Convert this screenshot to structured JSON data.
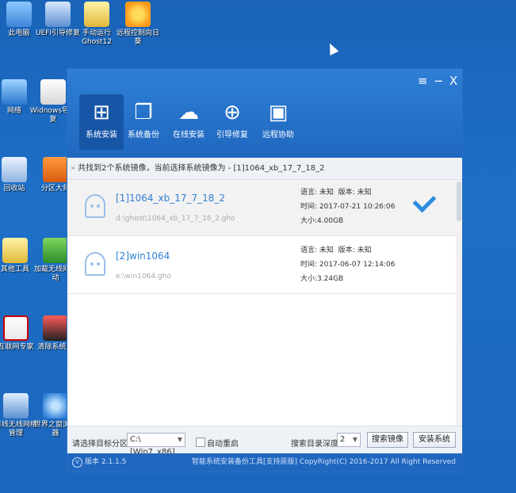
{
  "desktop": {
    "icons": [
      {
        "label": "此电脑",
        "icon": "computer-icon"
      },
      {
        "label": "UEFI引导修复",
        "icon": "tool-icon"
      },
      {
        "label": "手动运行Ghost12",
        "icon": "ghost-icon"
      },
      {
        "label": "远程控制向日葵",
        "icon": "sunflower-icon"
      },
      {
        "label": "网络",
        "icon": "network-icon"
      },
      {
        "label": "Widnows导修复",
        "icon": "windows-repair-icon"
      },
      {
        "label": "回收站",
        "icon": "recycle-bin-icon"
      },
      {
        "label": "分区大师",
        "icon": "partition-icon"
      },
      {
        "label": "其他工具",
        "icon": "folder-icon"
      },
      {
        "label": "加载无线网驱动",
        "icon": "wifi-icon"
      },
      {
        "label": "互联网专家",
        "icon": "pdf-icon"
      },
      {
        "label": "清除系统密",
        "icon": "clear-icon"
      },
      {
        "label": "有线无线网络管理",
        "icon": "lan-icon"
      },
      {
        "label": "世界之窗浏览器",
        "icon": "browser-icon"
      }
    ]
  },
  "app": {
    "controls": {
      "menu": "≡",
      "minimize": "−",
      "close": "X"
    },
    "tools": [
      {
        "label": "系统安装",
        "icon": "windows-icon",
        "glyph": "⊞"
      },
      {
        "label": "系统备份",
        "icon": "backup-icon",
        "glyph": "❐"
      },
      {
        "label": "在线安装",
        "icon": "cloud-download-icon",
        "glyph": "☁"
      },
      {
        "label": "引导修复",
        "icon": "toolbox-icon",
        "glyph": "⊕"
      },
      {
        "label": "远程协助",
        "icon": "remote-icon",
        "glyph": "▣"
      }
    ],
    "breadcrumb": "共找到2个系统镜像，当前选择系统镜像为 - [1]1064_xb_17_7_18_2",
    "images": [
      {
        "name": "[1]1064_xb_17_7_18_2",
        "path": "d:\\ghost\\1064_xb_17_7_18_2.gho",
        "lang_label": "语言:",
        "lang": "未知",
        "version_label": "版本:",
        "version": "未知",
        "time_label": "时间:",
        "time": "2017-07-21 10:26:06",
        "size_label": "大小:",
        "size": "4.00GB"
      },
      {
        "name": "[2]win1064",
        "path": "e:\\win1064.gho",
        "lang_label": "语言:",
        "lang": "未知",
        "version_label": "版本:",
        "version": "未知",
        "time_label": "时间:",
        "time": "2017-06-07 12:14:06",
        "size_label": "大小:",
        "size": "3.24GB"
      }
    ],
    "bottom": {
      "target_label": "请选择目标分区:",
      "target_value": "C:\\[Win7_x86]",
      "auto_restart": "自动重启",
      "depth_label": "搜索目录深度:",
      "depth_value": "2",
      "search_button": "搜索镜像",
      "install_button": "安装系统"
    },
    "footer": {
      "version": "版本 2.1.1.5",
      "copyright": "智能系统安装备份工具[支持原版]  CopyRight(C) 2016-2017 All Right Reserved"
    }
  }
}
